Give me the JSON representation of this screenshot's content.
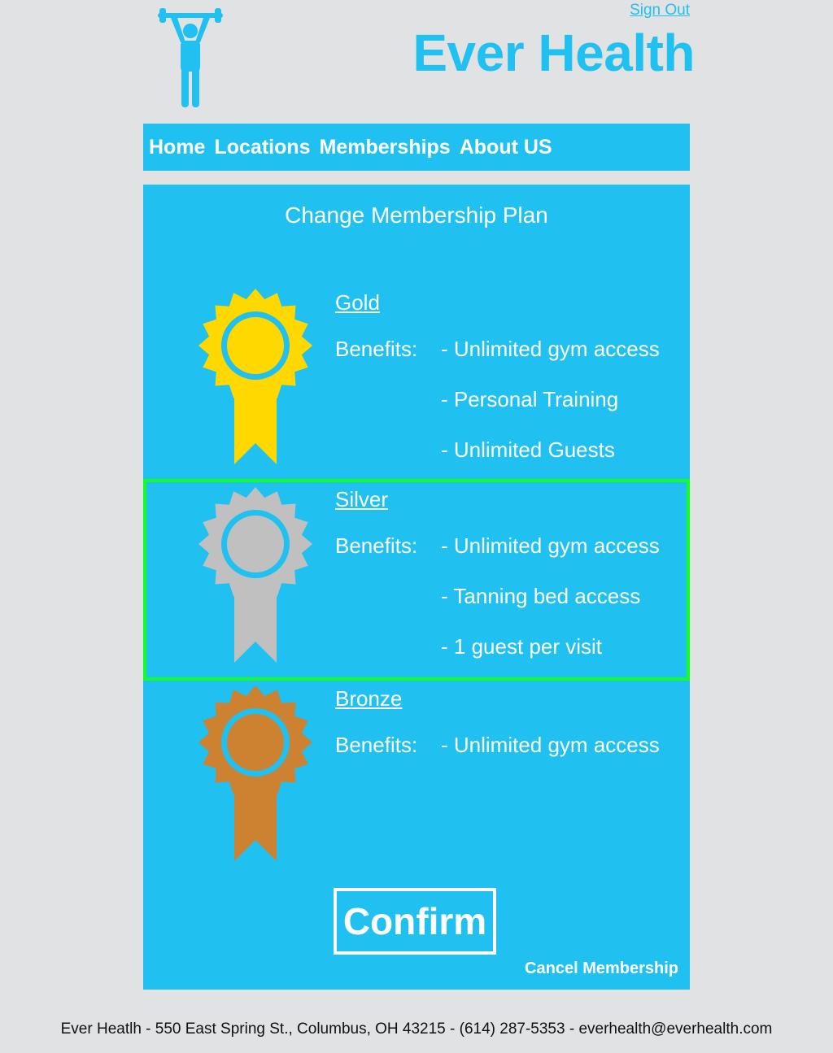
{
  "header": {
    "sign_out": "Sign Out",
    "brand": "Ever Health"
  },
  "nav": {
    "items": [
      "Home",
      "Locations",
      "Memberships",
      "About US"
    ]
  },
  "panel": {
    "title": "Change Membership Plan",
    "benefits_label": "Benefits:",
    "plans": [
      {
        "name": "Gold",
        "color": "#ffd800",
        "selected": false,
        "benefits": [
          "- Unlimited gym access",
          "- Personal Training",
          "- Unlimited Guests"
        ]
      },
      {
        "name": "Silver",
        "color": "#c0c0c0",
        "selected": true,
        "benefits": [
          "- Unlimited gym access",
          "- Tanning bed access",
          "- 1 guest per visit"
        ]
      },
      {
        "name": "Bronze",
        "color": "#cd8232",
        "selected": false,
        "benefits": [
          "- Unlimited gym access"
        ]
      }
    ],
    "confirm": "Confirm",
    "cancel": "Cancel Membership"
  },
  "footer": {
    "text": "Ever Heatlh - 550 East Spring St., Columbus, OH 43215 - (614) 287-5353 - everhealth@everhealth.com"
  },
  "colors": {
    "accent": "#20c0f0",
    "page_bg": "#e1e2e4",
    "selected_outline": "#10ff28"
  }
}
